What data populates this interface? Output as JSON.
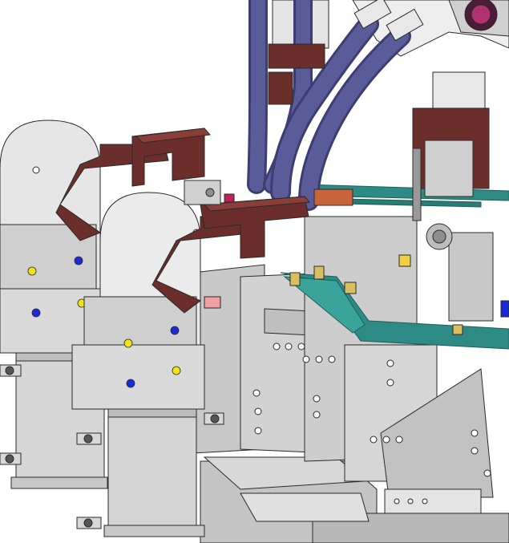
{
  "scene": {
    "background_color": "#ffffff",
    "colors": {
      "steel_light": "#e6e6e6",
      "steel_mid": "#c4c4c4",
      "steel_dark": "#8e8e8e",
      "edge": "#2a2a2a",
      "clamp_brown": "#6b2e2a",
      "clamp_brown_dark": "#4a1c1a",
      "cable_blue": "#5a5c9a",
      "cable_blue_dark": "#3c3d70",
      "rail_teal": "#2e8a84",
      "rail_teal_dark": "#1e5e5a",
      "marker_yellow": "#f2e21a",
      "marker_blue": "#1a2bd6",
      "copper": "#c8643c",
      "pink_pad": "#f0a0a0",
      "magenta_tag": "#c0205a",
      "brass_block": "#d8c060"
    },
    "components": [
      "left-cylinder-assembly-1",
      "left-cylinder-assembly-2",
      "toggle-clamp-arm-1",
      "toggle-clamp-arm-2",
      "cable-harness-bundle",
      "robot-wrist-top-right",
      "teal-guide-rail",
      "center-fixture-plate",
      "base-plate",
      "right-clamp-block"
    ]
  }
}
